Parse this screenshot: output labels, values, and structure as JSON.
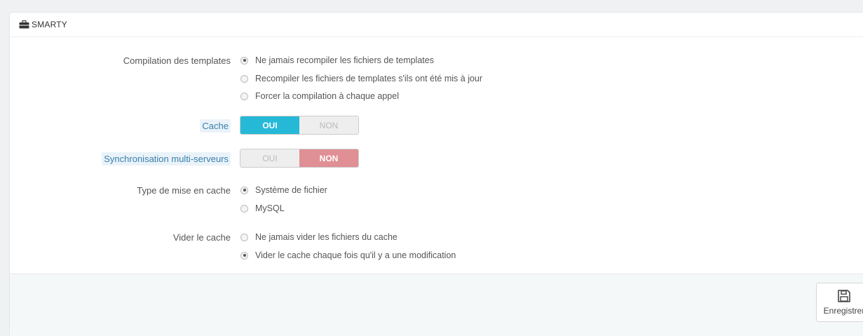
{
  "panel": {
    "title": "SMARTY",
    "icon": "briefcase-icon"
  },
  "compilation": {
    "label": "Compilation des templates",
    "options": [
      {
        "label": "Ne jamais recompiler les fichiers de templates",
        "checked": true
      },
      {
        "label": "Recompiler les fichiers de templates s'ils ont été mis à jour",
        "checked": false
      },
      {
        "label": "Forcer la compilation à chaque appel",
        "checked": false
      }
    ]
  },
  "cache": {
    "label": "Cache",
    "on_label": "OUI",
    "off_label": "NON",
    "value": "OUI"
  },
  "sync": {
    "label": "Synchronisation multi-serveurs",
    "on_label": "OUI",
    "off_label": "NON",
    "value": "NON"
  },
  "cache_type": {
    "label": "Type de mise en cache",
    "options": [
      {
        "label": "Système de fichier",
        "checked": true
      },
      {
        "label": "MySQL",
        "checked": false
      }
    ]
  },
  "clear_cache": {
    "label": "Vider le cache",
    "options": [
      {
        "label": "Ne jamais vider les fichiers du cache",
        "checked": false
      },
      {
        "label": "Vider le cache chaque fois qu'il y a une modification",
        "checked": true
      }
    ]
  },
  "footer": {
    "save_label": "Enregistrer",
    "save_icon": "floppy-disk-icon"
  },
  "colors": {
    "switch_on": "#25b9d7",
    "switch_off": "#e08f95",
    "help_label": "#3a7fad"
  }
}
